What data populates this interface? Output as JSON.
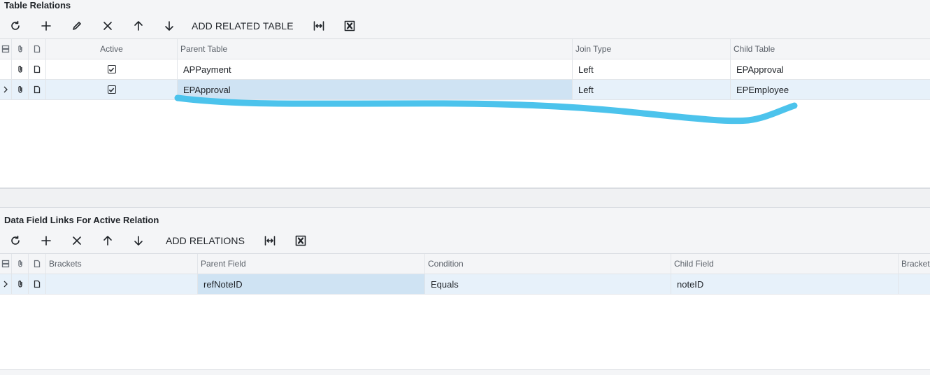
{
  "table_relations": {
    "title": "Table Relations",
    "toolbar": {
      "refresh_icon": "refresh-icon",
      "add_icon": "plus-icon",
      "edit_icon": "pencil-icon",
      "delete_icon": "close-icon",
      "up_icon": "arrow-up-icon",
      "down_icon": "arrow-down-icon",
      "add_related_label": "ADD RELATED TABLE",
      "fit_icon": "fit-columns-icon",
      "excel_icon": "excel-export-icon"
    },
    "columns": [
      "Active",
      "Parent Table",
      "Join Type",
      "Child Table"
    ],
    "rows": [
      {
        "active": true,
        "parent": "APPayment",
        "join": "Left",
        "child": "EPApproval"
      },
      {
        "active": true,
        "parent": "EPApproval",
        "join": "Left",
        "child": "EPEmployee"
      }
    ]
  },
  "field_links": {
    "title": "Data Field Links For Active Relation",
    "toolbar": {
      "refresh_icon": "refresh-icon",
      "add_icon": "plus-icon",
      "delete_icon": "close-icon",
      "up_icon": "arrow-up-icon",
      "down_icon": "arrow-down-icon",
      "add_relations_label": "ADD RELATIONS",
      "fit_icon": "fit-columns-icon",
      "excel_icon": "excel-export-icon"
    },
    "columns": [
      "Brackets",
      "Parent Field",
      "Condition",
      "Child Field",
      "Brackets"
    ],
    "rows": [
      {
        "brackets": "",
        "parent_field": "refNoteID",
        "condition": "Equals",
        "child_field": "noteID",
        "brackets_close": ""
      }
    ]
  },
  "colors": {
    "selected_row": "#e7f1fa",
    "active_cell": "#cfe3f3",
    "annotation_stroke": "#4cc3ec"
  }
}
